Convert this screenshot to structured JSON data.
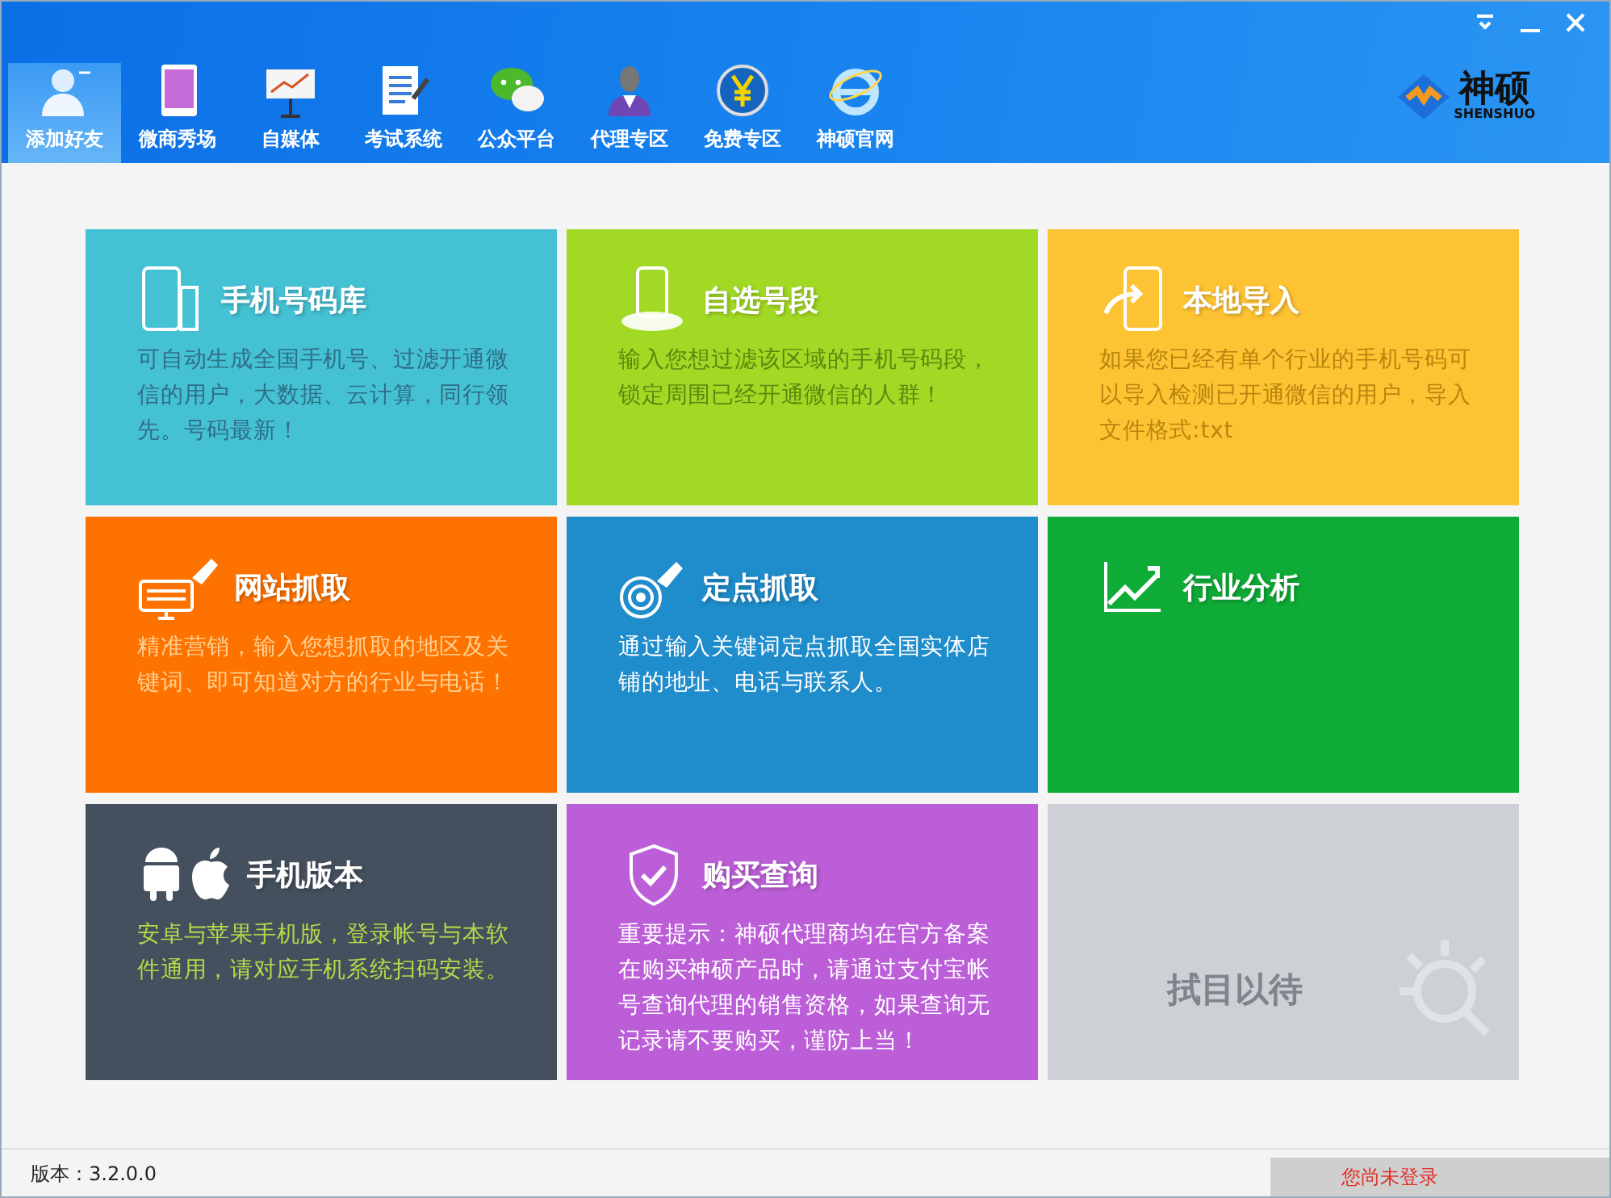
{
  "toolbar": [
    {
      "label": "添加好友",
      "selected": true
    },
    {
      "label": "微商秀场",
      "selected": false
    },
    {
      "label": "自媒体",
      "selected": false
    },
    {
      "label": "考试系统",
      "selected": false
    },
    {
      "label": "公众平台",
      "selected": false
    },
    {
      "label": "代理专区",
      "selected": false
    },
    {
      "label": "免费专区",
      "selected": false
    },
    {
      "label": "神硕官网",
      "selected": false
    }
  ],
  "logo": {
    "name": "神硕",
    "sub": "SHENSHUO"
  },
  "tiles": [
    {
      "kind": "feature",
      "title": "手机号码库",
      "description": "可自动生成全国手机号、过滤开通微信的用户，大数据、云计算，同行领先。号码最新！",
      "color": "#45c1d4"
    },
    {
      "kind": "feature",
      "title": "自选号段",
      "description": "输入您想过滤该区域的手机号码段，锁定周围已经开通微信的人群！",
      "color": "#a2d924"
    },
    {
      "kind": "feature",
      "title": "本地导入",
      "description": "如果您已经有单个行业的手机号码可以导入检测已开通微信的用户，导入文件格式:txt",
      "color": "#fec333"
    },
    {
      "kind": "feature",
      "title": "网站抓取",
      "description": "精准营销，输入您想抓取的地区及关键词、即可知道对方的行业与电话！",
      "color": "#fe7200"
    },
    {
      "kind": "feature",
      "title": "定点抓取",
      "description": "通过输入关键词定点抓取全国实体店铺的地址、电话与联系人。",
      "color": "#1f8ccb"
    },
    {
      "kind": "feature",
      "title": "行业分析",
      "color": "#0fab37"
    },
    {
      "kind": "feature",
      "title": "手机版本",
      "description": "安卓与苹果手机版，登录帐号与本软件通用，请对应手机系统扫码安装。",
      "color": "#45505e"
    },
    {
      "kind": "feature",
      "title": "购买查询",
      "description": "重要提示：神硕代理商均在官方备案在购买神硕产品时，请通过支付宝帐号查询代理的销售资格，如果查询无记录请不要购买，谨防上当！",
      "color": "#bd5ed9"
    },
    {
      "kind": "coming",
      "title": "拭目以待",
      "color": "#cdd1d6"
    }
  ],
  "status_bar": {
    "version": "版本：3.2.0.0",
    "login": "您尚未登录"
  }
}
